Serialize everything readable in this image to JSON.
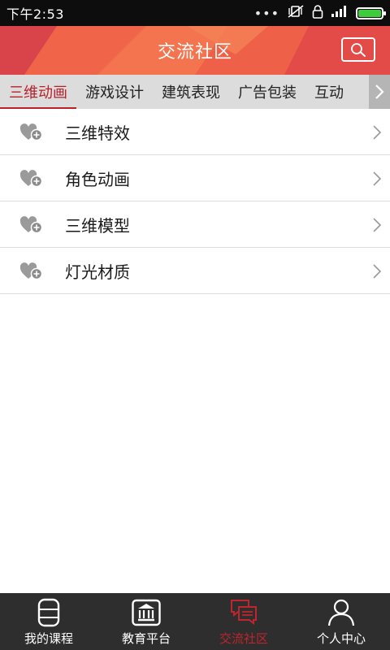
{
  "status_bar": {
    "time": "下午2:53",
    "dots": "•••",
    "icons": [
      "vibrate-off-icon",
      "lock-icon",
      "signal-icon",
      "battery-icon"
    ],
    "battery_level": 1.0
  },
  "header": {
    "title": "交流社区",
    "search_icon": "search-icon",
    "colors": {
      "base": "#e9533f",
      "light": "#f07a55",
      "dark": "#d43b43"
    }
  },
  "tabs": {
    "items": [
      {
        "label": "三维动画",
        "active": true
      },
      {
        "label": "游戏设计",
        "active": false
      },
      {
        "label": "建筑表现",
        "active": false
      },
      {
        "label": "广告包装",
        "active": false
      },
      {
        "label": "互动",
        "active": false
      }
    ],
    "more_icon": "chevron-right-icon",
    "active_color": "#b8202a"
  },
  "list": {
    "items": [
      {
        "label": "三维特效",
        "icon": "heart-add-icon"
      },
      {
        "label": "角色动画",
        "icon": "heart-add-icon"
      },
      {
        "label": "三维模型",
        "icon": "heart-add-icon"
      },
      {
        "label": "灯光材质",
        "icon": "heart-add-icon"
      }
    ]
  },
  "bottom_nav": {
    "items": [
      {
        "label": "我的课程",
        "icon": "book-icon",
        "active": false
      },
      {
        "label": "教育平台",
        "icon": "institution-icon",
        "active": false
      },
      {
        "label": "交流社区",
        "icon": "chat-bubbles-icon",
        "active": true
      },
      {
        "label": "个人中心",
        "icon": "user-icon",
        "active": false
      }
    ],
    "active_color": "#c0242c"
  }
}
